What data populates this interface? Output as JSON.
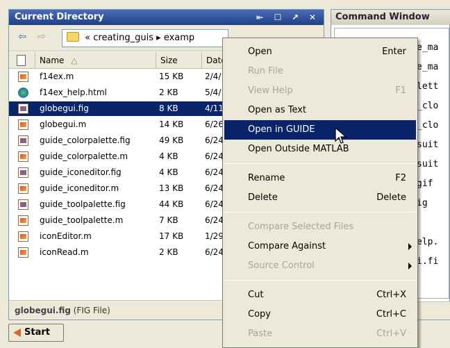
{
  "current_directory": {
    "title": "Current Directory",
    "title_buttons": [
      "⇤",
      "☐",
      "↗",
      "✕"
    ],
    "path_prefix": "«",
    "path_parts": [
      "creating_guis",
      "examp"
    ],
    "path_separator": "▸",
    "nav": {
      "back": "⇦",
      "forward": "⇨"
    },
    "columns": {
      "name": "Name",
      "sort_indicator": "△",
      "size": "Size",
      "date": "Date"
    },
    "files": [
      {
        "name": "f14ex.m",
        "size": "15 KB",
        "date": "2/4/",
        "icon": "m-file-icon"
      },
      {
        "name": "f14ex_help.html",
        "size": "2 KB",
        "date": "5/4/",
        "icon": "html-file-icon"
      },
      {
        "name": "globegui.fig",
        "size": "8 KB",
        "date": "4/11",
        "icon": "fig-file-icon",
        "selected": true
      },
      {
        "name": "globegui.m",
        "size": "14 KB",
        "date": "6/26",
        "icon": "m-file-icon"
      },
      {
        "name": "guide_colorpalette.fig",
        "size": "49 KB",
        "date": "6/24",
        "icon": "fig-file-icon"
      },
      {
        "name": "guide_colorpalette.m",
        "size": "4 KB",
        "date": "6/24",
        "icon": "m-file-icon"
      },
      {
        "name": "guide_iconeditor.fig",
        "size": "4 KB",
        "date": "6/24",
        "icon": "fig-file-icon"
      },
      {
        "name": "guide_iconeditor.m",
        "size": "13 KB",
        "date": "6/24",
        "icon": "m-file-icon"
      },
      {
        "name": "guide_toolpalette.fig",
        "size": "44 KB",
        "date": "6/24",
        "icon": "fig-file-icon"
      },
      {
        "name": "guide_toolpalette.m",
        "size": "7 KB",
        "date": "6/24",
        "icon": "m-file-icon"
      },
      {
        "name": "iconEditor.m",
        "size": "17 KB",
        "date": "1/29",
        "icon": "m-file-icon"
      },
      {
        "name": "iconRead.m",
        "size": "2 KB",
        "date": "6/24",
        "icon": "m-file-icon"
      }
    ],
    "status_file": "globegui.fig",
    "status_type": "(FIG File)"
  },
  "command_window": {
    "title": "Command Window",
    "lines": [
      "e_ma",
      "e_ma",
      "lett",
      "_clo",
      "_clo",
      "suit",
      "suit",
      "gif",
      "ig",
      "",
      "elp.",
      "i.fi"
    ]
  },
  "start_button": {
    "label": "Start"
  },
  "context_menu": {
    "groups": [
      [
        {
          "label": "Open",
          "accel": "Enter",
          "enabled": true
        },
        {
          "label": "Run File",
          "accel": "",
          "enabled": false
        },
        {
          "label": "View Help",
          "accel": "F1",
          "enabled": false
        },
        {
          "label": "Open as Text",
          "accel": "",
          "enabled": true
        },
        {
          "label": "Open in GUIDE",
          "accel": "",
          "enabled": true,
          "hover": true
        },
        {
          "label": "Open Outside MATLAB",
          "accel": "",
          "enabled": true
        }
      ],
      [
        {
          "label": "Rename",
          "accel": "F2",
          "enabled": true
        },
        {
          "label": "Delete",
          "accel": "Delete",
          "enabled": true
        }
      ],
      [
        {
          "label": "Compare Selected Files",
          "accel": "",
          "enabled": false
        },
        {
          "label": "Compare Against",
          "accel": "",
          "enabled": true,
          "submenu": true
        },
        {
          "label": "Source Control",
          "accel": "",
          "enabled": false,
          "submenu": true
        }
      ],
      [
        {
          "label": "Cut",
          "accel": "Ctrl+X",
          "enabled": true
        },
        {
          "label": "Copy",
          "accel": "Ctrl+C",
          "enabled": true
        },
        {
          "label": "Paste",
          "accel": "Ctrl+V",
          "enabled": false
        }
      ]
    ]
  }
}
